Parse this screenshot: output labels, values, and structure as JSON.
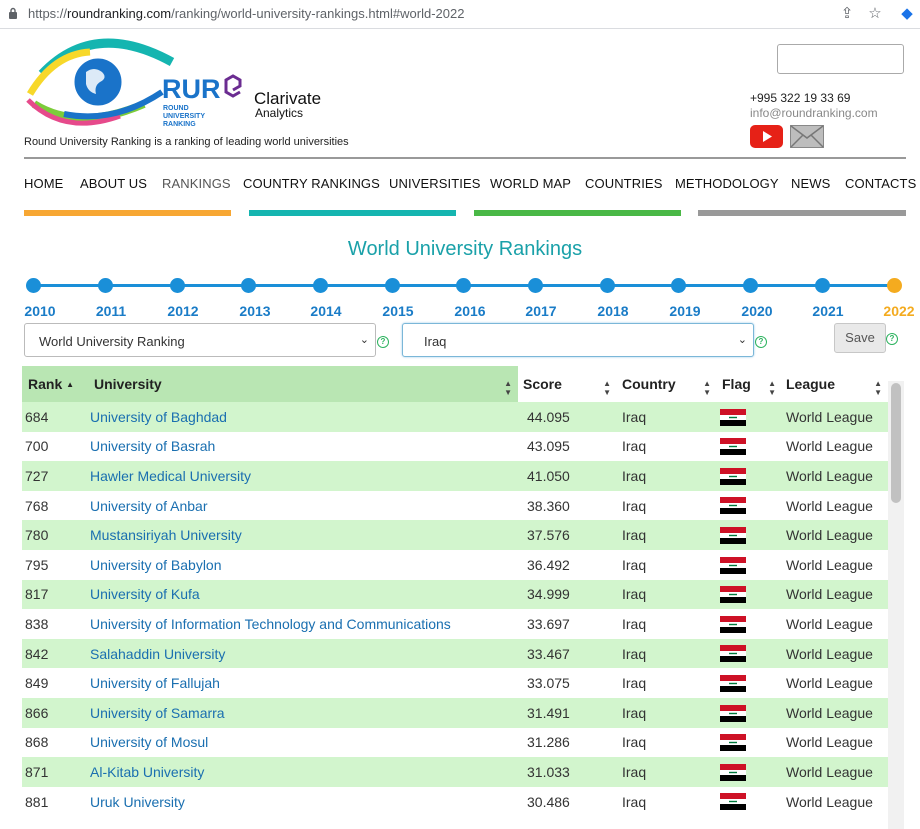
{
  "browser": {
    "url_prefix": "https://",
    "url_host": "roundranking.com",
    "url_path": "/ranking/world-university-rankings.html#world-2022"
  },
  "header": {
    "tagline": "Round University Ranking is a ranking of leading world universities",
    "phone": "+995 322 19 33 69",
    "email": "info@roundranking.com",
    "logo_rur": "RUR",
    "logo_sub1": "ROUND",
    "logo_sub2": "UNIVERSITY",
    "logo_sub3": "RANKING",
    "partner_name": "Clarivate",
    "partner_sub": "Analytics"
  },
  "nav": [
    "HOME",
    "ABOUT US",
    "RANKINGS",
    "COUNTRY RANKINGS",
    "UNIVERSITIES",
    "WORLD MAP",
    "COUNTRIES",
    "METHODOLOGY",
    "NEWS",
    "CONTACTS"
  ],
  "colors": {
    "orange": "#f7a733",
    "teal": "#15b5b0",
    "green": "#4ab846",
    "gray": "#999999",
    "accent": "#1aa1a9"
  },
  "page_title": "World University Rankings",
  "years": [
    "2010",
    "2011",
    "2012",
    "2013",
    "2014",
    "2015",
    "2016",
    "2017",
    "2018",
    "2019",
    "2020",
    "2021",
    "2022"
  ],
  "current_year": "2022",
  "filters": {
    "ranking": "World University Ranking",
    "country": "Iraq",
    "save_label": "Save"
  },
  "table": {
    "headers": {
      "rank": "Rank",
      "university": "University",
      "score": "Score",
      "country": "Country",
      "flag": "Flag",
      "league": "League"
    },
    "rows": [
      {
        "rank": "684",
        "university": "University of Baghdad",
        "score": "44.095",
        "country": "Iraq",
        "league": "World League"
      },
      {
        "rank": "700",
        "university": "University of Basrah",
        "score": "43.095",
        "country": "Iraq",
        "league": "World League"
      },
      {
        "rank": "727",
        "university": "Hawler Medical University",
        "score": "41.050",
        "country": "Iraq",
        "league": "World League"
      },
      {
        "rank": "768",
        "university": "University of Anbar",
        "score": "38.360",
        "country": "Iraq",
        "league": "World League"
      },
      {
        "rank": "780",
        "university": "Mustansiriyah University",
        "score": "37.576",
        "country": "Iraq",
        "league": "World League"
      },
      {
        "rank": "795",
        "university": "University of Babylon",
        "score": "36.492",
        "country": "Iraq",
        "league": "World League"
      },
      {
        "rank": "817",
        "university": "University of Kufa",
        "score": "34.999",
        "country": "Iraq",
        "league": "World League"
      },
      {
        "rank": "838",
        "university": "University of Information Technology and Communications",
        "score": "33.697",
        "country": "Iraq",
        "league": "World League"
      },
      {
        "rank": "842",
        "university": "Salahaddin University",
        "score": "33.467",
        "country": "Iraq",
        "league": "World League"
      },
      {
        "rank": "849",
        "university": "University of Fallujah",
        "score": "33.075",
        "country": "Iraq",
        "league": "World League"
      },
      {
        "rank": "866",
        "university": "University of Samarra",
        "score": "31.491",
        "country": "Iraq",
        "league": "World League"
      },
      {
        "rank": "868",
        "university": "University of Mosul",
        "score": "31.286",
        "country": "Iraq",
        "league": "World League"
      },
      {
        "rank": "871",
        "university": "Al-Kitab University",
        "score": "31.033",
        "country": "Iraq",
        "league": "World League"
      },
      {
        "rank": "881",
        "university": "Uruk University",
        "score": "30.486",
        "country": "Iraq",
        "league": "World League"
      }
    ]
  }
}
